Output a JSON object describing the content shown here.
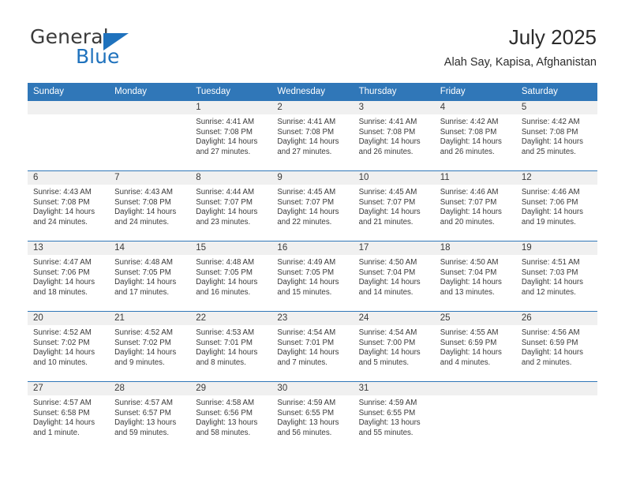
{
  "brand": {
    "name_part1": "General",
    "name_part2": "Blue",
    "triangle_color": "#1f72bd",
    "icon": "triangle-icon"
  },
  "header": {
    "title": "July 2025",
    "subtitle": "Alah Say, Kapisa, Afghanistan"
  },
  "theme": {
    "header_blue": "#3077b8",
    "day_band_gray": "#f0f0f0",
    "text_dark": "#3a3a3a"
  },
  "weekdays": [
    "Sunday",
    "Monday",
    "Tuesday",
    "Wednesday",
    "Thursday",
    "Friday",
    "Saturday"
  ],
  "weeks": [
    [
      {
        "day": "",
        "lines": []
      },
      {
        "day": "",
        "lines": []
      },
      {
        "day": "1",
        "lines": [
          "Sunrise: 4:41 AM",
          "Sunset: 7:08 PM",
          "Daylight: 14 hours",
          "and 27 minutes."
        ]
      },
      {
        "day": "2",
        "lines": [
          "Sunrise: 4:41 AM",
          "Sunset: 7:08 PM",
          "Daylight: 14 hours",
          "and 27 minutes."
        ]
      },
      {
        "day": "3",
        "lines": [
          "Sunrise: 4:41 AM",
          "Sunset: 7:08 PM",
          "Daylight: 14 hours",
          "and 26 minutes."
        ]
      },
      {
        "day": "4",
        "lines": [
          "Sunrise: 4:42 AM",
          "Sunset: 7:08 PM",
          "Daylight: 14 hours",
          "and 26 minutes."
        ]
      },
      {
        "day": "5",
        "lines": [
          "Sunrise: 4:42 AM",
          "Sunset: 7:08 PM",
          "Daylight: 14 hours",
          "and 25 minutes."
        ]
      }
    ],
    [
      {
        "day": "6",
        "lines": [
          "Sunrise: 4:43 AM",
          "Sunset: 7:08 PM",
          "Daylight: 14 hours",
          "and 24 minutes."
        ]
      },
      {
        "day": "7",
        "lines": [
          "Sunrise: 4:43 AM",
          "Sunset: 7:08 PM",
          "Daylight: 14 hours",
          "and 24 minutes."
        ]
      },
      {
        "day": "8",
        "lines": [
          "Sunrise: 4:44 AM",
          "Sunset: 7:07 PM",
          "Daylight: 14 hours",
          "and 23 minutes."
        ]
      },
      {
        "day": "9",
        "lines": [
          "Sunrise: 4:45 AM",
          "Sunset: 7:07 PM",
          "Daylight: 14 hours",
          "and 22 minutes."
        ]
      },
      {
        "day": "10",
        "lines": [
          "Sunrise: 4:45 AM",
          "Sunset: 7:07 PM",
          "Daylight: 14 hours",
          "and 21 minutes."
        ]
      },
      {
        "day": "11",
        "lines": [
          "Sunrise: 4:46 AM",
          "Sunset: 7:07 PM",
          "Daylight: 14 hours",
          "and 20 minutes."
        ]
      },
      {
        "day": "12",
        "lines": [
          "Sunrise: 4:46 AM",
          "Sunset: 7:06 PM",
          "Daylight: 14 hours",
          "and 19 minutes."
        ]
      }
    ],
    [
      {
        "day": "13",
        "lines": [
          "Sunrise: 4:47 AM",
          "Sunset: 7:06 PM",
          "Daylight: 14 hours",
          "and 18 minutes."
        ]
      },
      {
        "day": "14",
        "lines": [
          "Sunrise: 4:48 AM",
          "Sunset: 7:05 PM",
          "Daylight: 14 hours",
          "and 17 minutes."
        ]
      },
      {
        "day": "15",
        "lines": [
          "Sunrise: 4:48 AM",
          "Sunset: 7:05 PM",
          "Daylight: 14 hours",
          "and 16 minutes."
        ]
      },
      {
        "day": "16",
        "lines": [
          "Sunrise: 4:49 AM",
          "Sunset: 7:05 PM",
          "Daylight: 14 hours",
          "and 15 minutes."
        ]
      },
      {
        "day": "17",
        "lines": [
          "Sunrise: 4:50 AM",
          "Sunset: 7:04 PM",
          "Daylight: 14 hours",
          "and 14 minutes."
        ]
      },
      {
        "day": "18",
        "lines": [
          "Sunrise: 4:50 AM",
          "Sunset: 7:04 PM",
          "Daylight: 14 hours",
          "and 13 minutes."
        ]
      },
      {
        "day": "19",
        "lines": [
          "Sunrise: 4:51 AM",
          "Sunset: 7:03 PM",
          "Daylight: 14 hours",
          "and 12 minutes."
        ]
      }
    ],
    [
      {
        "day": "20",
        "lines": [
          "Sunrise: 4:52 AM",
          "Sunset: 7:02 PM",
          "Daylight: 14 hours",
          "and 10 minutes."
        ]
      },
      {
        "day": "21",
        "lines": [
          "Sunrise: 4:52 AM",
          "Sunset: 7:02 PM",
          "Daylight: 14 hours",
          "and 9 minutes."
        ]
      },
      {
        "day": "22",
        "lines": [
          "Sunrise: 4:53 AM",
          "Sunset: 7:01 PM",
          "Daylight: 14 hours",
          "and 8 minutes."
        ]
      },
      {
        "day": "23",
        "lines": [
          "Sunrise: 4:54 AM",
          "Sunset: 7:01 PM",
          "Daylight: 14 hours",
          "and 7 minutes."
        ]
      },
      {
        "day": "24",
        "lines": [
          "Sunrise: 4:54 AM",
          "Sunset: 7:00 PM",
          "Daylight: 14 hours",
          "and 5 minutes."
        ]
      },
      {
        "day": "25",
        "lines": [
          "Sunrise: 4:55 AM",
          "Sunset: 6:59 PM",
          "Daylight: 14 hours",
          "and 4 minutes."
        ]
      },
      {
        "day": "26",
        "lines": [
          "Sunrise: 4:56 AM",
          "Sunset: 6:59 PM",
          "Daylight: 14 hours",
          "and 2 minutes."
        ]
      }
    ],
    [
      {
        "day": "27",
        "lines": [
          "Sunrise: 4:57 AM",
          "Sunset: 6:58 PM",
          "Daylight: 14 hours",
          "and 1 minute."
        ]
      },
      {
        "day": "28",
        "lines": [
          "Sunrise: 4:57 AM",
          "Sunset: 6:57 PM",
          "Daylight: 13 hours",
          "and 59 minutes."
        ]
      },
      {
        "day": "29",
        "lines": [
          "Sunrise: 4:58 AM",
          "Sunset: 6:56 PM",
          "Daylight: 13 hours",
          "and 58 minutes."
        ]
      },
      {
        "day": "30",
        "lines": [
          "Sunrise: 4:59 AM",
          "Sunset: 6:55 PM",
          "Daylight: 13 hours",
          "and 56 minutes."
        ]
      },
      {
        "day": "31",
        "lines": [
          "Sunrise: 4:59 AM",
          "Sunset: 6:55 PM",
          "Daylight: 13 hours",
          "and 55 minutes."
        ]
      },
      {
        "day": "",
        "lines": []
      },
      {
        "day": "",
        "lines": []
      }
    ]
  ]
}
